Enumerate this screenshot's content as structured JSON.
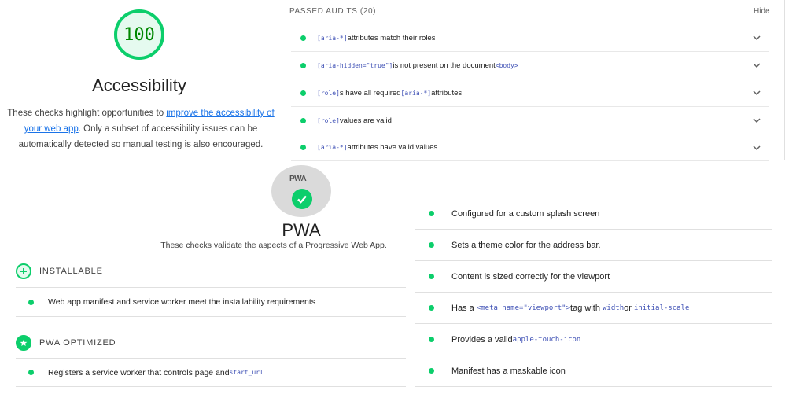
{
  "accessibility": {
    "score": "100",
    "title": "Accessibility",
    "desc_before": "These checks highlight opportunities to ",
    "desc_link": "improve the accessibility of your web app",
    "desc_after": ". Only a subset of accessibility issues can be automatically detected so manual testing is also encouraged.",
    "score_color": "#0cce6b"
  },
  "passed_audits": {
    "title": "PASSED AUDITS (20)",
    "hide_label": "Hide",
    "items": [
      {
        "code": "[aria-*]",
        "text": " attributes match their roles"
      },
      {
        "code": "[aria-hidden=\"true\"]",
        "text": " is not present on the document ",
        "code2": "<body>"
      },
      {
        "code": "[role]",
        "text": "s have all required ",
        "code2": "[aria-*]",
        "text2": " attributes"
      },
      {
        "code": "[role]",
        "text": " values are valid"
      },
      {
        "code": "[aria-*]",
        "text": " attributes have valid values"
      }
    ]
  },
  "pwa": {
    "badge_text": "PWA",
    "title": "PWA",
    "desc": "These checks validate the aspects of a Progressive Web App.",
    "installable": {
      "label": "INSTALLABLE",
      "items": [
        "Web app manifest and service worker meet the installability requirements"
      ]
    },
    "optimized": {
      "label": "PWA OPTIMIZED",
      "items": [
        {
          "text": "Registers a service worker that controls page and ",
          "code": "start_url"
        }
      ]
    },
    "right_items": [
      {
        "text": "Configured for a custom splash screen"
      },
      {
        "text": "Sets a theme color for the address bar."
      },
      {
        "text": "Content is sized correctly for the viewport"
      },
      {
        "text": "Has a ",
        "code": "<meta name=\"viewport\">",
        "text2": " tag with ",
        "code2": "width",
        "text3": " or ",
        "code3": "initial-scale"
      },
      {
        "text": "Provides a valid ",
        "code": "apple-touch-icon"
      },
      {
        "text": "Manifest has a maskable icon"
      }
    ]
  }
}
